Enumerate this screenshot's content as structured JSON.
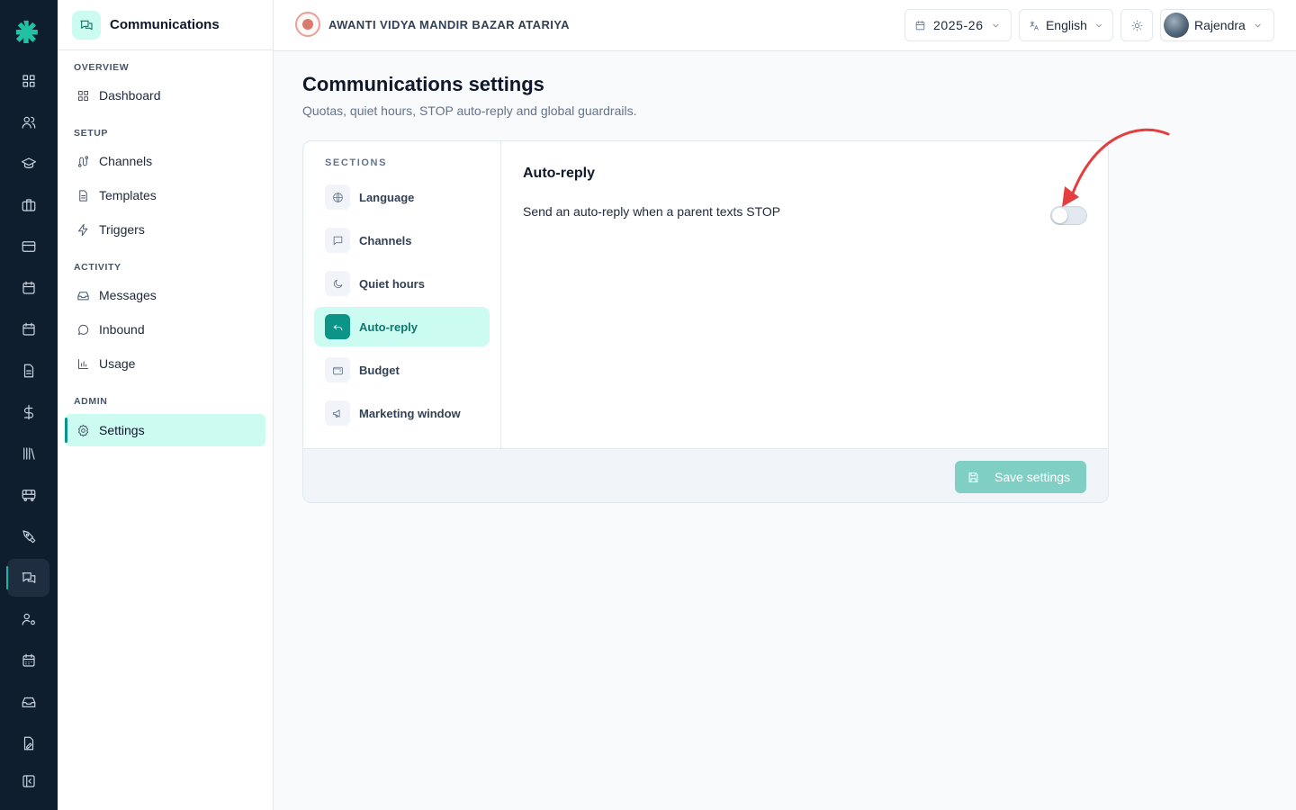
{
  "colors": {
    "accent": "#0d9488",
    "accent_soft": "#ccfbf1",
    "rail_bg": "#0f1e2e",
    "annotation": "#e53e3e"
  },
  "rail": {
    "icons": [
      "dashboard-icon",
      "users-icon",
      "graduation-cap-icon",
      "briefcase-icon",
      "credit-card-icon",
      "calendar-icon",
      "calendar-alt-icon",
      "document-icon",
      "dollar-icon",
      "library-icon",
      "bus-icon",
      "pen-tool-icon",
      "chat-icon",
      "user-settings-icon",
      "calendar-grid-icon",
      "inbox-tray-icon",
      "file-edit-icon",
      "collapse-icon"
    ],
    "active": "chat-icon"
  },
  "sidebar": {
    "title": "Communications",
    "groups": [
      {
        "label": "OVERVIEW",
        "items": [
          {
            "label": "Dashboard",
            "icon": "grid-icon"
          }
        ]
      },
      {
        "label": "SETUP",
        "items": [
          {
            "label": "Channels",
            "icon": "route-icon"
          },
          {
            "label": "Templates",
            "icon": "file-icon"
          },
          {
            "label": "Triggers",
            "icon": "zap-icon"
          }
        ]
      },
      {
        "label": "ACTIVITY",
        "items": [
          {
            "label": "Messages",
            "icon": "inbox-icon"
          },
          {
            "label": "Inbound",
            "icon": "message-circle-icon"
          },
          {
            "label": "Usage",
            "icon": "bar-chart-icon"
          }
        ]
      },
      {
        "label": "ADMIN",
        "items": [
          {
            "label": "Settings",
            "icon": "gear-icon",
            "active": true
          }
        ]
      }
    ]
  },
  "topbar": {
    "school_name": "AWANTI VIDYA MANDIR BAZAR ATARIYA",
    "year": "2025-26",
    "language": "English",
    "user": "Rajendra"
  },
  "page": {
    "title": "Communications settings",
    "subtitle": "Quotas, quiet hours, STOP auto-reply and global guardrails."
  },
  "sections": {
    "label": "SECTIONS",
    "items": [
      {
        "label": "Language",
        "icon": "globe-icon"
      },
      {
        "label": "Channels",
        "icon": "message-square-icon"
      },
      {
        "label": "Quiet hours",
        "icon": "moon-icon"
      },
      {
        "label": "Auto-reply",
        "icon": "reply-icon",
        "active": true
      },
      {
        "label": "Budget",
        "icon": "wallet-icon"
      },
      {
        "label": "Marketing window",
        "icon": "megaphone-icon"
      }
    ]
  },
  "panel": {
    "title": "Auto-reply",
    "setting_label": "Send an auto-reply when a parent texts STOP",
    "toggle_on": false
  },
  "footer": {
    "save_label": "Save settings"
  }
}
